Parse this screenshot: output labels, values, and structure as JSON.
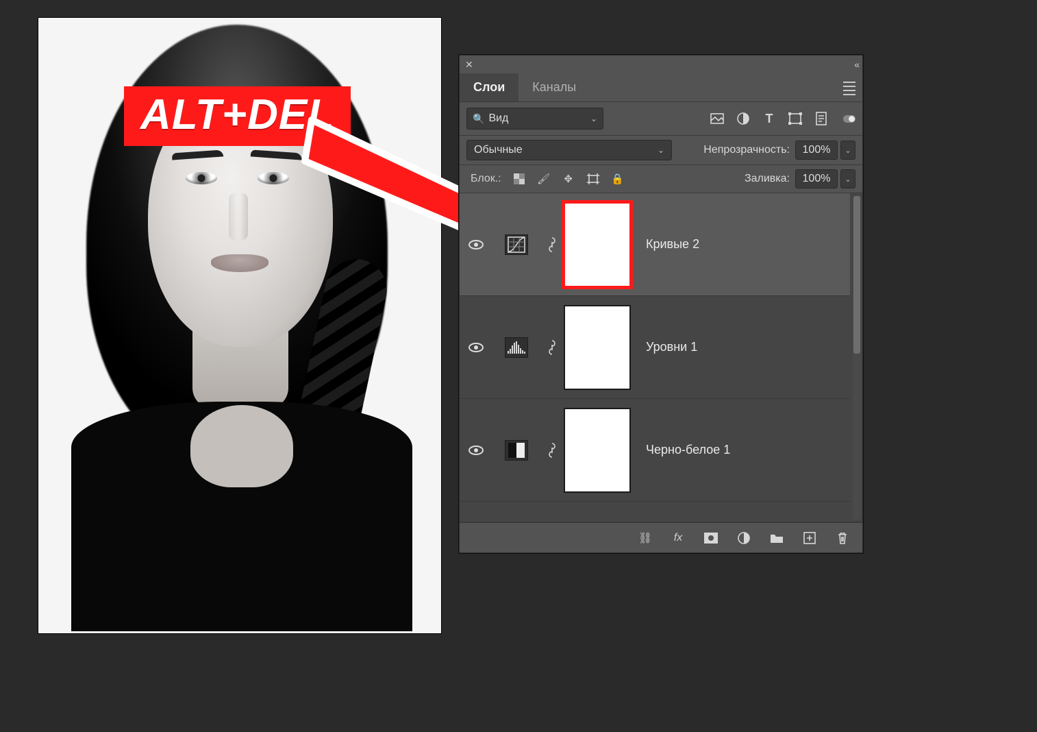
{
  "badge": {
    "text": "ALT+DEL"
  },
  "panel": {
    "tabs": {
      "layers": "Слои",
      "channels": "Каналы"
    },
    "search": {
      "label": "Вид"
    },
    "blend": {
      "mode": "Обычные",
      "opacity_label": "Непрозрачность:",
      "opacity_value": "100%",
      "fill_label": "Заливка:",
      "fill_value": "100%",
      "lock_label": "Блок.:"
    },
    "layers": [
      {
        "name": "Кривые 2",
        "selected": true,
        "highlight_mask": true,
        "adj": "curves"
      },
      {
        "name": "Уровни 1",
        "selected": false,
        "highlight_mask": false,
        "adj": "levels"
      },
      {
        "name": "Черно-белое 1",
        "selected": false,
        "highlight_mask": false,
        "adj": "bw"
      }
    ]
  }
}
